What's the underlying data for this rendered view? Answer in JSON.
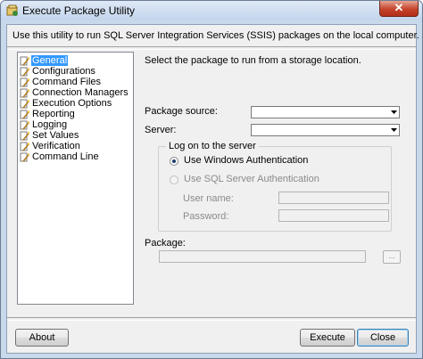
{
  "window": {
    "title": "Execute Package Utility",
    "close_glyph": "✕"
  },
  "header": {
    "description": "Use this utility to run SQL Server Integration Services (SSIS) packages on the local computer."
  },
  "nav": {
    "items": [
      {
        "label": "General",
        "selected": true
      },
      {
        "label": "Configurations"
      },
      {
        "label": "Command Files"
      },
      {
        "label": "Connection Managers"
      },
      {
        "label": "Execution Options"
      },
      {
        "label": "Reporting"
      },
      {
        "label": "Logging"
      },
      {
        "label": "Set Values"
      },
      {
        "label": "Verification"
      },
      {
        "label": "Command Line"
      }
    ],
    "icon": "page-wand-icon"
  },
  "panel": {
    "instruction": "Select the package to run from a storage location.",
    "package_source_label": "Package source:",
    "package_source_value": "",
    "server_label": "Server:",
    "server_value": "",
    "logon": {
      "title": "Log on to the server",
      "windows_auth_label": "Use Windows Authentication",
      "sql_auth_label": "Use SQL Server Authentication",
      "selected": "windows",
      "username_label": "User name:",
      "username_value": "",
      "password_label": "Password:",
      "password_value": ""
    },
    "package_label": "Package:",
    "package_value": "",
    "browse_label": "..."
  },
  "footer": {
    "about_label": "About",
    "execute_label": "Execute",
    "close_label": "Close"
  },
  "colors": {
    "selection": "#3399ff",
    "frame": "#c9d9ec"
  }
}
